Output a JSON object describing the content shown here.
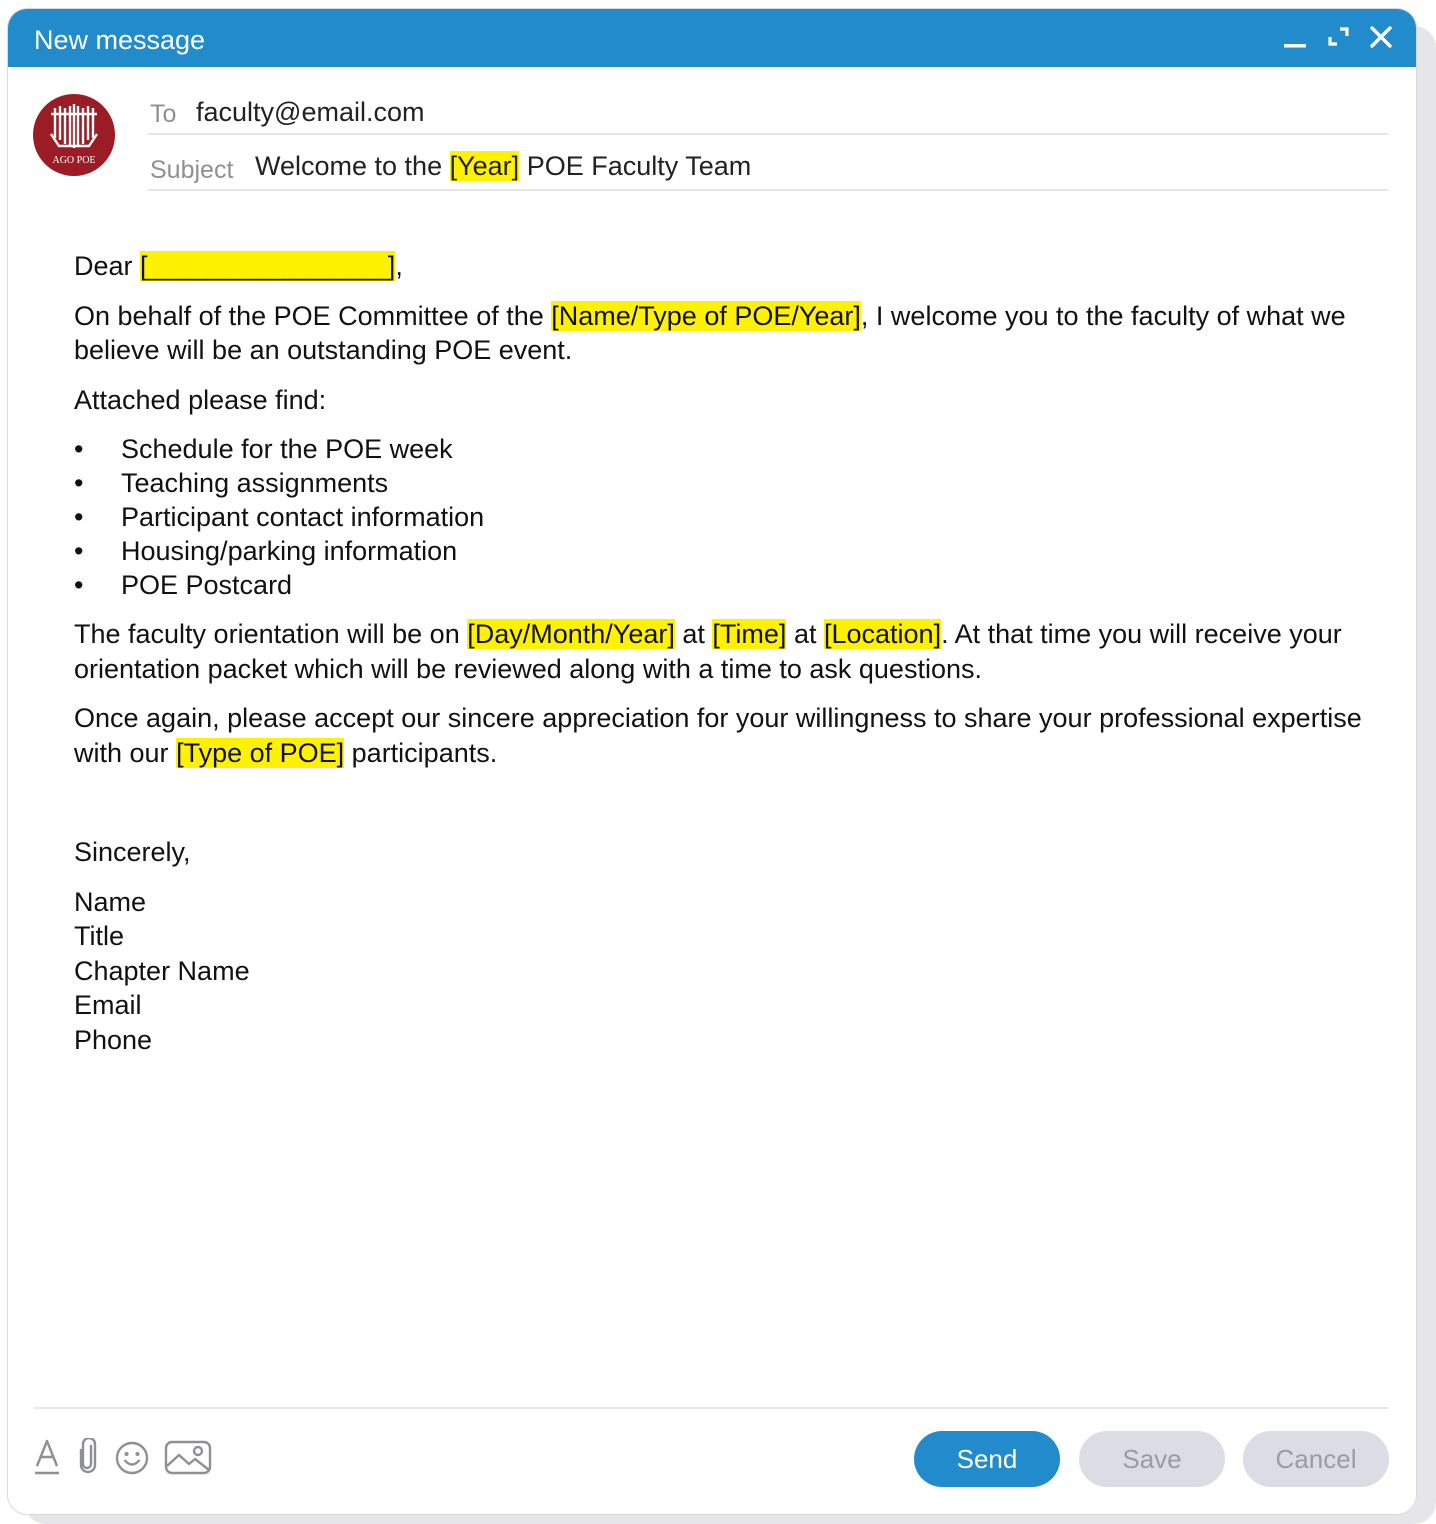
{
  "window": {
    "title": "New message"
  },
  "header": {
    "to_label": "To",
    "to_value": "faculty@email.com",
    "subject_label": "Subject",
    "subject_pre": "Welcome to the",
    "subject_hl": "[Year]",
    "subject_post": "POE Faculty Team",
    "avatar_text": "AGO POE"
  },
  "message": {
    "greeting_pre": "Dear",
    "greeting_hl": "[________________]",
    "greeting_post": ",",
    "p1_pre": "On behalf of the POE Committee of the",
    "p1_hl": "[Name/Type of POE/Year]",
    "p1_post": ", I welcome you to the faculty of what we believe will be an outstanding POE event.",
    "attached_intro": "Attached please find:",
    "bullet_char": "•",
    "attachments": [
      "Schedule for the POE week",
      "Teaching assignments",
      "Participant contact information",
      "Housing/parking information",
      "POE Postcard"
    ],
    "p2_pre": "The faculty orientation will be on",
    "p2_hl1": "[Day/Month/Year]",
    "p2_mid1": "at",
    "p2_hl2": "[Time]",
    "p2_mid2": "at",
    "p2_hl3": "[Location]",
    "p2_post": ". At that time you will receive your orientation packet which will be reviewed along with a time to ask questions.",
    "p3_pre": "Once again, please accept our sincere appreciation for your willingness to share your professional expertise with our",
    "p3_hl": "[Type of POE]",
    "p3_post": "participants.",
    "closing": "Sincerely,",
    "signature": [
      "Name",
      "Title",
      "Chapter Name",
      "Email",
      "Phone"
    ]
  },
  "footer": {
    "send_label": "Send",
    "save_label": "Save",
    "cancel_label": "Cancel",
    "tools": [
      "text-format-icon",
      "paperclip-icon",
      "emoji-icon",
      "image-icon"
    ]
  },
  "colors": {
    "accent": "#228bcc",
    "highlight": "#fff200",
    "avatar": "#9b1c24",
    "disabled_button": "#dcdce4"
  }
}
